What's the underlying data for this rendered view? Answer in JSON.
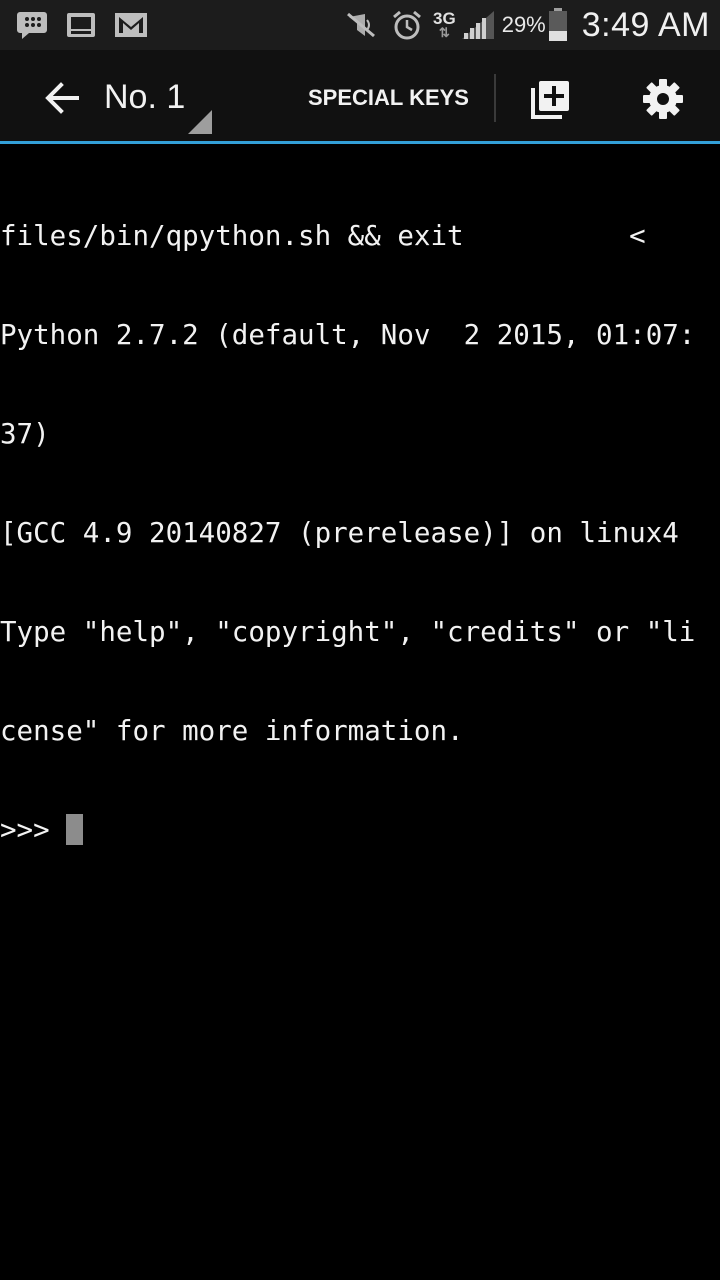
{
  "status_bar": {
    "left_icons": [
      "blackberry-messenger-icon",
      "screen-icon",
      "gmail-icon"
    ],
    "network_type": "3G",
    "network_arrows": "⇅",
    "battery_percent": "29%",
    "time": "3:49 AM"
  },
  "action_bar": {
    "session_title": "No. 1",
    "special_keys_label": "SPECIAL KEYS",
    "accent_color": "#33a0d8"
  },
  "terminal": {
    "lines": [
      "files/bin/qpython.sh && exit          <",
      "Python 2.7.2 (default, Nov  2 2015, 01:07:",
      "37)",
      "[GCC 4.9 20140827 (prerelease)] on linux4",
      "Type \"help\", \"copyright\", \"credits\" or \"li",
      "cense\" for more information.",
      ">>> "
    ]
  }
}
